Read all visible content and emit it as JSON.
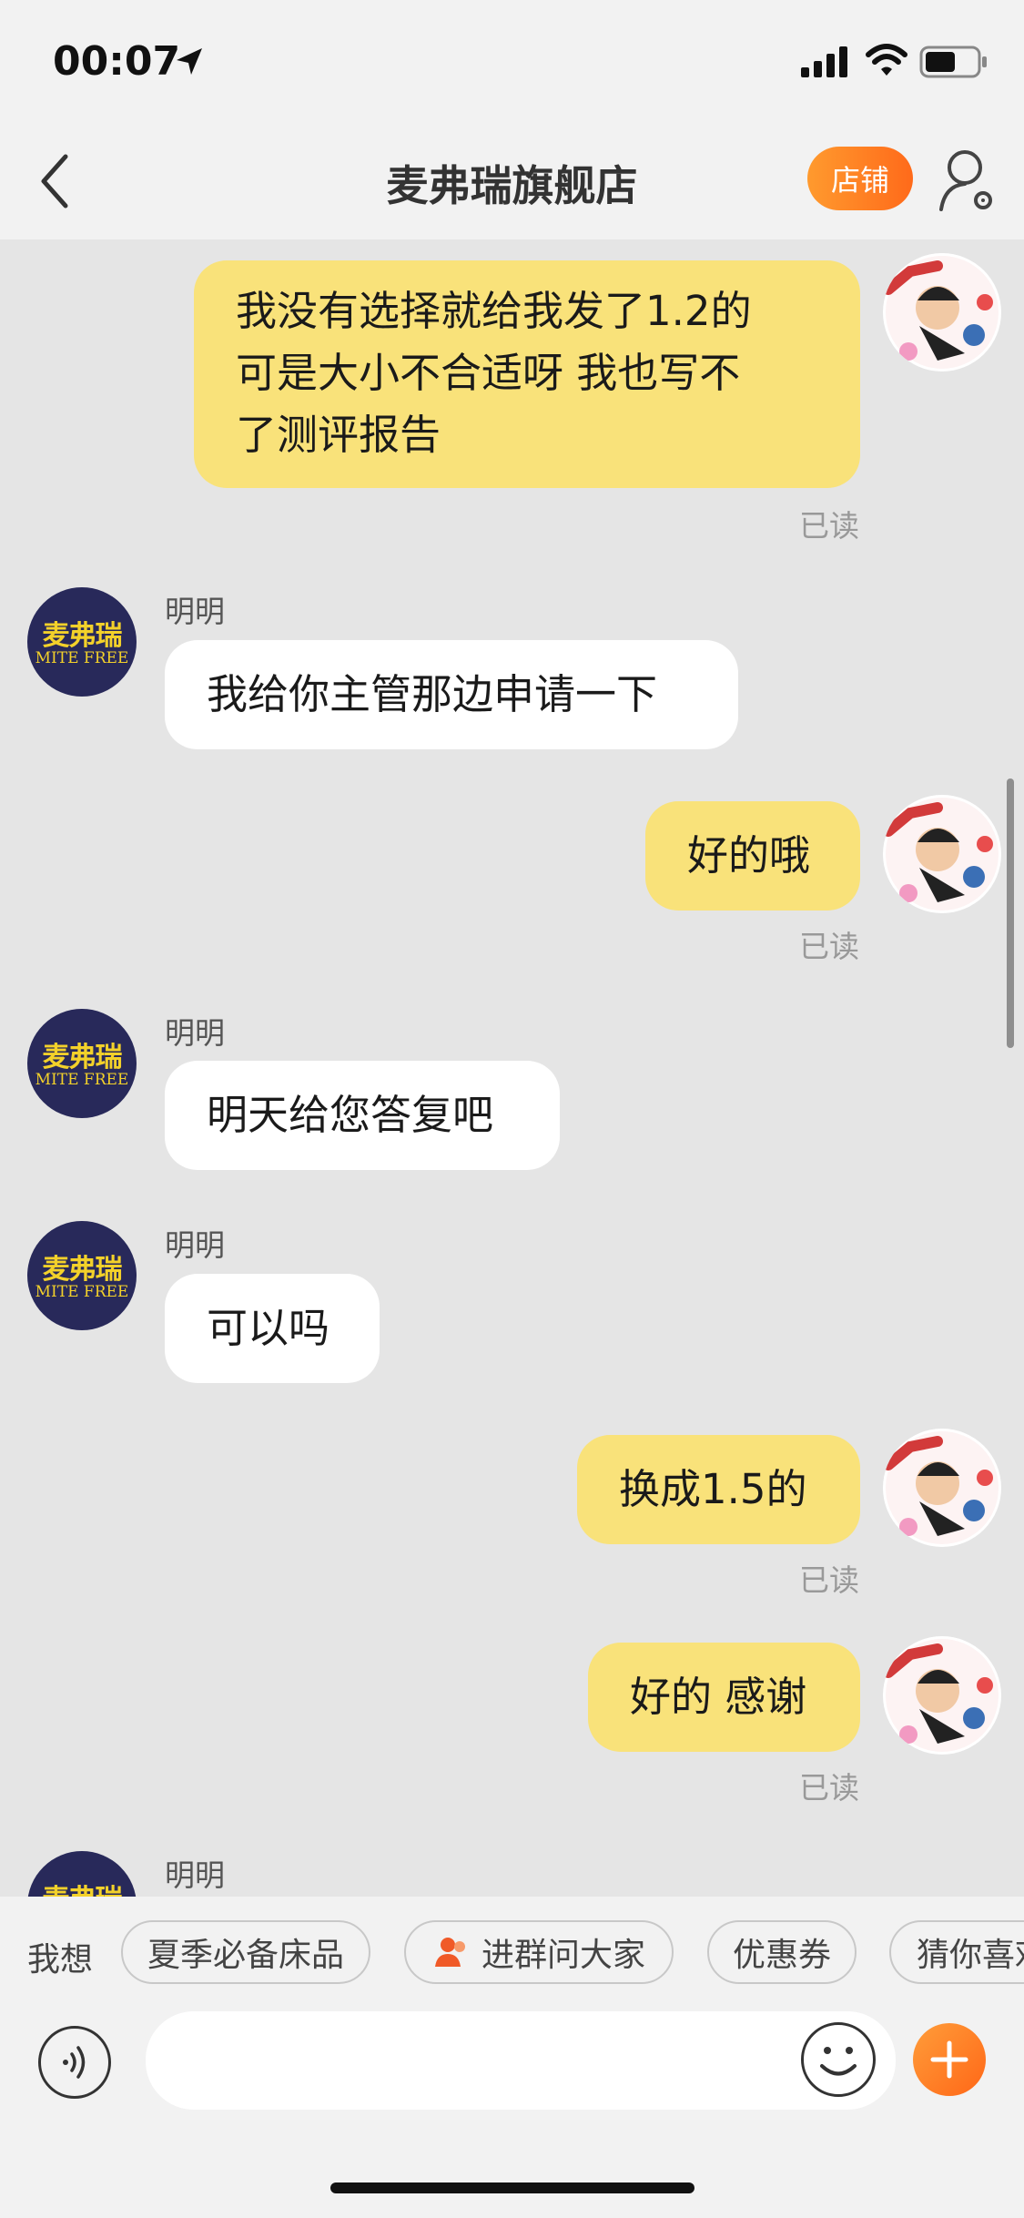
{
  "status_bar": {
    "time": "00:07"
  },
  "header": {
    "title": "麦弗瑞旗舰店",
    "store_button": "店铺"
  },
  "shop_avatar": {
    "line1": "麦弗瑞",
    "line2": "MITE FREE"
  },
  "messages": [
    {
      "side": "me",
      "lines": [
        "我没有选择就给我发了1.2的",
        "可是大小不合适呀 我也写不",
        "了测评报告"
      ],
      "read": "已读"
    },
    {
      "side": "shop",
      "sender": "明明",
      "text": "我给你主管那边申请一下"
    },
    {
      "side": "me",
      "text": "好的哦",
      "read": "已读"
    },
    {
      "side": "shop",
      "sender": "明明",
      "text": "明天给您答复吧"
    },
    {
      "side": "shop",
      "sender": "明明",
      "text": "可以吗"
    },
    {
      "side": "me",
      "text": "换成1.5的",
      "read": "已读"
    },
    {
      "side": "me",
      "text": "好的 感谢",
      "read": "已读"
    },
    {
      "side": "shop",
      "sender": "明明"
    }
  ],
  "quick_bar": {
    "label": "我想",
    "chips": [
      "夏季必备床品",
      "进群问大家",
      "优惠券",
      "猜你喜欢"
    ]
  },
  "colors": {
    "my_bubble": "#f9e27a",
    "their_bubble": "#ffffff",
    "accent": "#ff7a1f",
    "shop_avatar_bg": "#28295a"
  }
}
